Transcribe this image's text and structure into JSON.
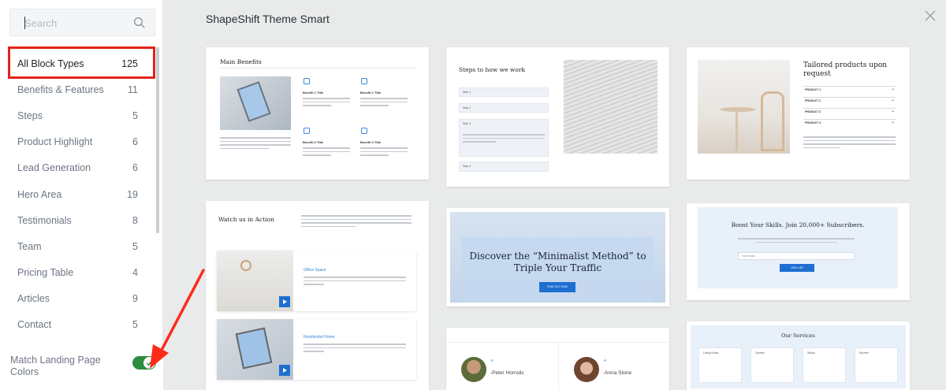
{
  "sidebar": {
    "search_placeholder": "Search",
    "categories": [
      {
        "label": "All Block Types",
        "count": "125"
      },
      {
        "label": "Benefits & Features",
        "count": "11"
      },
      {
        "label": "Steps",
        "count": "5"
      },
      {
        "label": "Product Highlight",
        "count": "6"
      },
      {
        "label": "Lead Generation",
        "count": "6"
      },
      {
        "label": "Hero Area",
        "count": "19"
      },
      {
        "label": "Testimonials",
        "count": "8"
      },
      {
        "label": "Team",
        "count": "5"
      },
      {
        "label": "Pricing Table",
        "count": "4"
      },
      {
        "label": "Articles",
        "count": "9"
      },
      {
        "label": "Contact",
        "count": "5"
      }
    ],
    "match_colors_label": "Match Landing Page Colors",
    "match_colors_on": true
  },
  "main": {
    "title": "ShapeShift Theme Smart",
    "cards": {
      "main_benefits": {
        "title": "Main Benefits",
        "benefit_1": "Benefit 1 Title",
        "benefit_2": "Benefit 2 Title",
        "benefit_3": "Benefit 3 Title",
        "benefit_4": "Benefit 4 Title"
      },
      "steps": {
        "title": "Steps to how we work",
        "step_1": "Step 1",
        "step_2": "Step 2",
        "step_3": "Step 3",
        "step_4": "Step 4"
      },
      "tailored": {
        "title": "Tailored products upon request",
        "products": [
          "PRODUCT 1",
          "PRODUCT 2",
          "PRODUCT 3",
          "PRODUCT 4"
        ]
      },
      "watch": {
        "title": "Watch us in Action",
        "feature_1": "Office Space",
        "feature_2": "Residential Home"
      },
      "minimalist": {
        "title": "Discover the “Minimalist Method” to Triple Your Traffic",
        "button": "FIND OUT HOW"
      },
      "subscribe": {
        "title": "Boost Your Skills. Join 20,000+ Subscribers.",
        "input_placeholder": "Your email",
        "button": "JOIN LIST"
      },
      "testimonials": {
        "name_1": "-Peter Horrods",
        "name_2": "-Anna Stone"
      },
      "services": {
        "title": "Our Services",
        "columns": [
          "Living Room",
          "Garden",
          "Studio",
          "Kitchen"
        ]
      }
    }
  },
  "colors": {
    "accent": "#1d6fd1",
    "highlight": "#e2231a",
    "toggle_on": "#2e8b3f"
  }
}
